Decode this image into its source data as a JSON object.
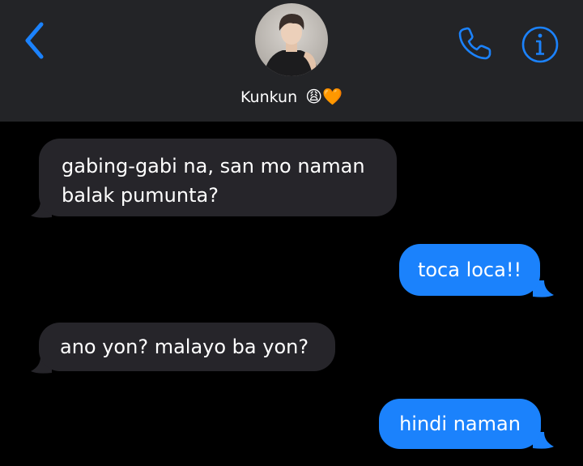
{
  "header": {
    "contact_name": "Kunkun",
    "contact_emojis": "😩🧡",
    "accent_color": "#1b82fc",
    "icons": [
      "chevron-left-icon",
      "avatar",
      "phone-icon",
      "info-icon"
    ]
  },
  "messages": [
    {
      "direction": "incoming",
      "text": "gabing-gabi na, san mo naman balak pumunta?"
    },
    {
      "direction": "outgoing",
      "text": "toca loca!!"
    },
    {
      "direction": "incoming",
      "text": "ano yon? malayo ba yon?"
    },
    {
      "direction": "outgoing",
      "text": "hindi naman"
    }
  ],
  "colors": {
    "header_bg": "#232427",
    "background": "#000000",
    "incoming_bubble": "#26252a",
    "outgoing_bubble": "#1b82fc",
    "text": "#ffffff"
  }
}
